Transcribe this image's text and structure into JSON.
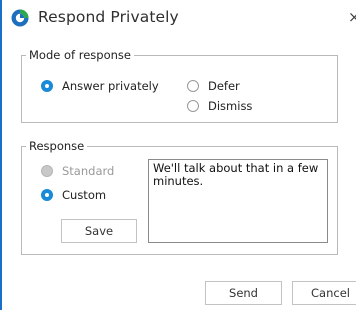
{
  "window": {
    "title": "Respond Privately",
    "close_glyph": "×",
    "accent_color": "#1a6fc9"
  },
  "mode": {
    "legend": "Mode of response",
    "options": [
      {
        "label": "Answer privately",
        "checked": true
      },
      {
        "label": "Defer",
        "checked": false
      },
      {
        "label": "Dismiss",
        "checked": false
      }
    ]
  },
  "response": {
    "legend": "Response",
    "options": [
      {
        "label": "Standard",
        "checked": false,
        "disabled": true
      },
      {
        "label": "Custom",
        "checked": true,
        "disabled": false
      }
    ],
    "save_label": "Save",
    "text_value": "We'll talk about that in a few minutes."
  },
  "footer": {
    "send_label": "Send",
    "cancel_label": "Cancel"
  },
  "icons": {
    "app": "app-icon",
    "close": "close-icon",
    "radio_checked_color": "#1a8ad8"
  }
}
